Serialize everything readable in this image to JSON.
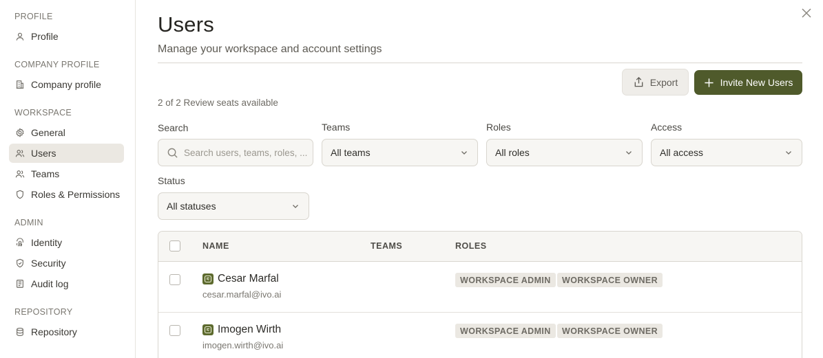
{
  "sidebar": {
    "sections": [
      {
        "title": "PROFILE",
        "items": [
          {
            "label": "Profile",
            "icon": "user-icon"
          }
        ]
      },
      {
        "title": "COMPANY PROFILE",
        "items": [
          {
            "label": "Company profile",
            "icon": "building-icon"
          }
        ]
      },
      {
        "title": "WORKSPACE",
        "items": [
          {
            "label": "General",
            "icon": "gear-icon"
          },
          {
            "label": "Users",
            "icon": "users-icon",
            "active": true
          },
          {
            "label": "Teams",
            "icon": "team-icon"
          },
          {
            "label": "Roles & Permissions",
            "icon": "shield-icon"
          }
        ]
      },
      {
        "title": "ADMIN",
        "items": [
          {
            "label": "Identity",
            "icon": "fingerprint-icon"
          },
          {
            "label": "Security",
            "icon": "shield-check-icon"
          },
          {
            "label": "Audit log",
            "icon": "audit-log-icon"
          }
        ]
      },
      {
        "title": "REPOSITORY",
        "items": [
          {
            "label": "Repository",
            "icon": "database-icon"
          }
        ]
      }
    ]
  },
  "header": {
    "title": "Users",
    "subtitle": "Manage your workspace and account settings"
  },
  "actions": {
    "export_label": "Export",
    "invite_label": "Invite New Users",
    "accent_color": "#4f5a2b"
  },
  "seats_text": "2 of 2 Review seats available",
  "filters": {
    "search": {
      "label": "Search",
      "placeholder": "Search users, teams, roles, ..."
    },
    "teams": {
      "label": "Teams",
      "value": "All teams"
    },
    "roles": {
      "label": "Roles",
      "value": "All roles"
    },
    "access": {
      "label": "Access",
      "value": "All access"
    },
    "status": {
      "label": "Status",
      "value": "All statuses"
    }
  },
  "table": {
    "columns": {
      "name": "NAME",
      "teams": "TEAMS",
      "roles": "ROLES"
    },
    "rows": [
      {
        "name": "Cesar Marfal",
        "email": "cesar.marfal@ivo.ai",
        "teams": "",
        "roles": [
          "WORKSPACE ADMIN",
          "WORKSPACE OWNER"
        ]
      },
      {
        "name": "Imogen Wirth",
        "email": "imogen.wirth@ivo.ai",
        "teams": "",
        "roles": [
          "WORKSPACE ADMIN",
          "WORKSPACE OWNER"
        ]
      }
    ]
  }
}
